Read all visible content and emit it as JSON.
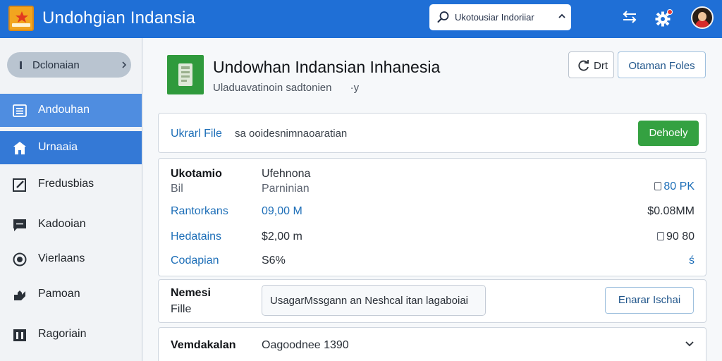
{
  "app": {
    "title": "Undohgian Indansia",
    "search_value": "Ukotousiar Indoriiar",
    "colors": {
      "topbar": "#1f6fd6",
      "sidebar_active": "#3479d6",
      "primary_button": "#34a141",
      "link": "#1e6fb8"
    }
  },
  "icons": {
    "logo": "star-logo-icon",
    "search": "search-icon",
    "settings_toggle": "sliders-icon",
    "notifications": "gear-notification-icon",
    "user": "avatar"
  },
  "sidebar": {
    "selector_label": "Dclonaian",
    "items": [
      {
        "label": "Andouhan",
        "icon": "list-icon"
      },
      {
        "label": "Urnaaia",
        "icon": "home-icon"
      },
      {
        "label": "Fredusbias",
        "icon": "edit-icon"
      },
      {
        "label": "Kadooian",
        "icon": "comment-icon"
      },
      {
        "label": "Vierlaans",
        "icon": "eye-icon"
      },
      {
        "label": "Pamoan",
        "icon": "puzzle-icon"
      },
      {
        "label": "Ragoriain",
        "icon": "grid-icon"
      }
    ]
  },
  "header": {
    "title": "Undowhan Indansian Inhanesia",
    "subtitle": "Uladuavatinoin sadtonien",
    "subtitle_suffix": "·y",
    "refresh_label": "Drt",
    "open_label": "Otaman Foles"
  },
  "upload": {
    "label": "Ukrarl File",
    "description": "sa ooidesnimnaoaratian",
    "button_label": "Dehoely"
  },
  "details": {
    "header_label": "Ukotamio",
    "header_sublabel": "Bil",
    "header_value": "Ufehnona",
    "header_subvalue": "Parninian",
    "header_right": "80 PK",
    "rows": [
      {
        "label": "Rantorkans",
        "value": "09,00 M",
        "right": "$0.08MM"
      },
      {
        "label": "Hedatains",
        "value": "$2,00 m",
        "right": "90 80"
      },
      {
        "label": "Codapian",
        "value": "S6%",
        "right": "ś"
      }
    ]
  },
  "message": {
    "label": "Nemesi",
    "sublabel": "Fille",
    "input_value": "UsagarMssgann an Neshcal itan lagaboiai",
    "button_label": "Enarar Ischai"
  },
  "select": {
    "label": "Vemdakalan",
    "value": "Oagoodnee 1390"
  }
}
